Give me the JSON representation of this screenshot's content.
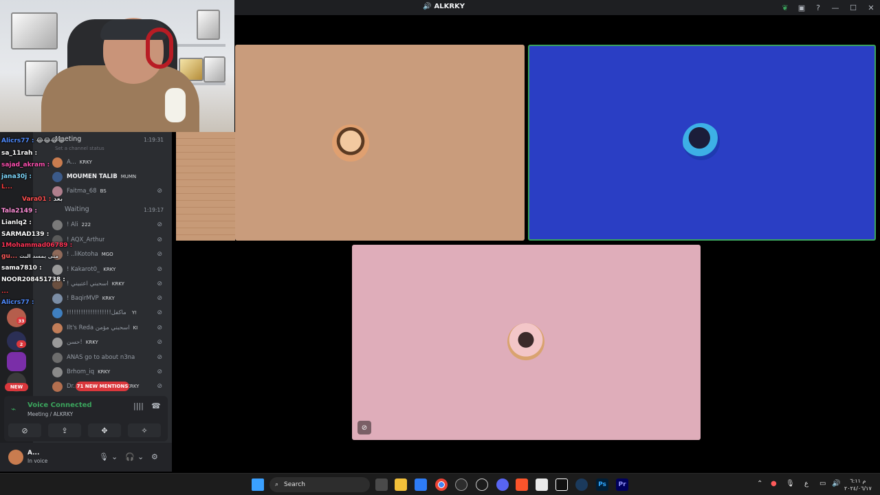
{
  "window": {
    "title": "ALKRKY",
    "title_icon": "speaker-icon"
  },
  "titlebar_icons": [
    "nitro-leaf-icon",
    "inbox-icon",
    "help-icon",
    "minimize-icon",
    "maximize-icon",
    "close-icon"
  ],
  "stream_chat": [
    {
      "user": "Alicrs77 :",
      "color": "#4f8bff",
      "extra": "😂😂😂😂"
    },
    {
      "user": "sa_11rah :",
      "color": "#ffffff",
      "extra": ""
    },
    {
      "user": "sajad_akram :",
      "color": "#ff4fb0",
      "extra": ""
    },
    {
      "user": "jana30j :",
      "color": "#7ed9ff",
      "extra": ""
    },
    {
      "user": "L...",
      "color": "#ff3b3b",
      "extra": ""
    },
    {
      "user": "Vara01 :",
      "color": "#ff4f4f",
      "extra": "بعد"
    },
    {
      "user": "Tala2149 :",
      "color": "#ff8fd8",
      "extra": ""
    },
    {
      "user": "Lianlq2 :",
      "color": "#ffffff",
      "extra": ""
    },
    {
      "user": "SARMAD139 :",
      "color": "#ffffff",
      "extra": ""
    },
    {
      "user": "1Mohammad06789 :",
      "color": "#ff3355",
      "extra": ""
    },
    {
      "user": "gu...",
      "color": "#ff5a5a",
      "extra": "متى يمسد البث"
    },
    {
      "user": "sama7810 :",
      "color": "#ffffff",
      "extra": ""
    },
    {
      "user": "NOOR208451738 :",
      "color": "#ffffff",
      "extra": ""
    },
    {
      "user": "...",
      "color": "#ff3b3b",
      "extra": ""
    },
    {
      "user": "Alicrs77 :",
      "color": "#4f8bff",
      "extra": ""
    }
  ],
  "sidebar": {
    "channels": [
      {
        "name": "Meeting",
        "time": "1:19:31",
        "status": "Set a channel status"
      },
      {
        "name": "Waiting",
        "time": "1:19:17"
      }
    ],
    "meeting_members": [
      {
        "name": "A...",
        "badge": "KRKY",
        "color": "#c97c4f"
      },
      {
        "name": "MOUMEN TALIB",
        "badge": "MUMN",
        "color": "#3b5a8a"
      },
      {
        "name": "Faitma_68",
        "badge": "BS",
        "color": "#b07f8d"
      }
    ],
    "waiting_members": [
      {
        "name": "! Ali",
        "badge": "222",
        "color": "#7a7a7a"
      },
      {
        "name": "! AQX_Arthur",
        "badge": "",
        "color": "#5a5a5a"
      },
      {
        "name": "! ..liKotoha",
        "badge": "MGO",
        "color": "#8f6a5a"
      },
      {
        "name": "! Kakarot0_",
        "badge": "KRKY",
        "color": "#9a9a9a"
      },
      {
        "name": "! اسحبني اعتبيني",
        "badge": "KRKY",
        "color": "#6a4f3f"
      },
      {
        "name": "! BaqirMVP",
        "badge": "KRKY",
        "color": "#7b8da5"
      },
      {
        "name": "!!!!!!!!!!!!!!!!!!!محتاج ما ماكفل",
        "badge": "Y!",
        "color": "#3f7fbf"
      },
      {
        "name": "Ilt's Reda اسحبني مؤمن",
        "badge": "KI",
        "color": "#c27d58"
      },
      {
        "name": "حسن!",
        "badge": "KRKY",
        "color": "#9a9a9a"
      },
      {
        "name": "ANAS go to about n3na",
        "badge": "",
        "color": "#6d6d6d"
      },
      {
        "name": "Brhom_iq",
        "badge": "KRKY",
        "color": "#8a8a8a"
      },
      {
        "name": "Dr...",
        "badge": "KRKY",
        "color": "#b36f4f"
      }
    ],
    "guild_badges": [
      "33",
      "2"
    ],
    "new_label": "NEW",
    "mentions_label": "71 NEW MENTIONS"
  },
  "voice": {
    "status": "Voice Connected",
    "location": "Meeting / ALKRKY",
    "buttons": [
      "camera-off-icon",
      "screen-share-icon",
      "activities-icon",
      "soundboard-icon"
    ]
  },
  "user": {
    "name": "A...",
    "status": "In voice"
  },
  "taskbar": {
    "search_label": "Search",
    "apps": [
      "windows-start-icon",
      "task-view-icon",
      "file-explorer-icon",
      "store-icon",
      "chrome-icon",
      "obs-icon",
      "steam-alt-icon",
      "discord-icon",
      "brave-icon",
      "notepad-icon",
      "capcut-icon",
      "steam-icon",
      "photoshop-icon",
      "premiere-icon"
    ],
    "ps_label": "Ps",
    "pr_label": "Pr",
    "tray_lang": "ع",
    "clock_time": "م ٦:١١",
    "clock_date": "٢٠٢٤/٠٦/١٧"
  },
  "colors": {
    "tile1": "#c99c7c",
    "tile2": "#2a3ec4",
    "tile3": "#dfadba",
    "speaking_border": "#3ba55d",
    "mention_red": "#da373c"
  }
}
